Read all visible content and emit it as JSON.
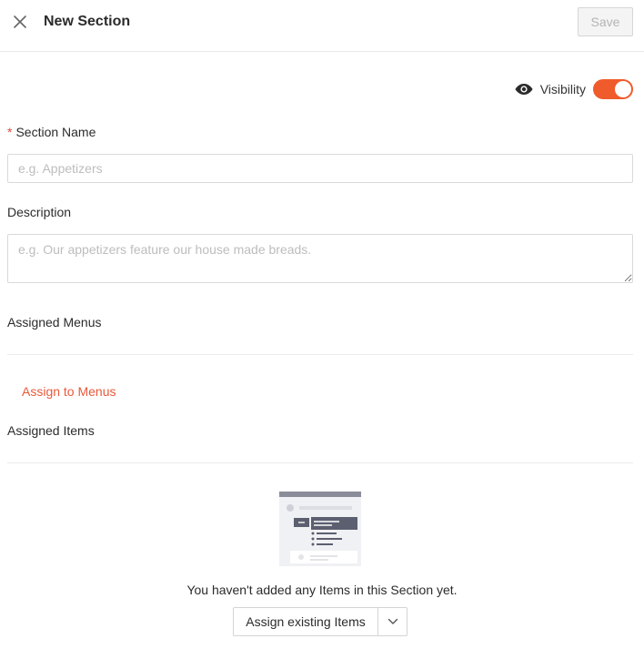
{
  "header": {
    "title": "New Section",
    "save_label": "Save",
    "close_icon": "close-icon"
  },
  "visibility": {
    "label": "Visibility",
    "icon": "eye-icon",
    "enabled": true,
    "accent": "#f05b2b"
  },
  "form": {
    "section_name": {
      "label": "Section Name",
      "required_marker": "*",
      "placeholder": "e.g. Appetizers",
      "value": ""
    },
    "description": {
      "label": "Description",
      "placeholder": "e.g. Our appetizers feature our house made breads.",
      "value": ""
    },
    "assigned_menus": {
      "label": "Assigned Menus",
      "link": "Assign to Menus"
    },
    "assigned_items": {
      "label": "Assigned Items",
      "empty_text": "You haven't added any Items in this Section yet.",
      "assign_button": "Assign existing Items",
      "dropdown_icon": "chevron-down-icon"
    }
  }
}
